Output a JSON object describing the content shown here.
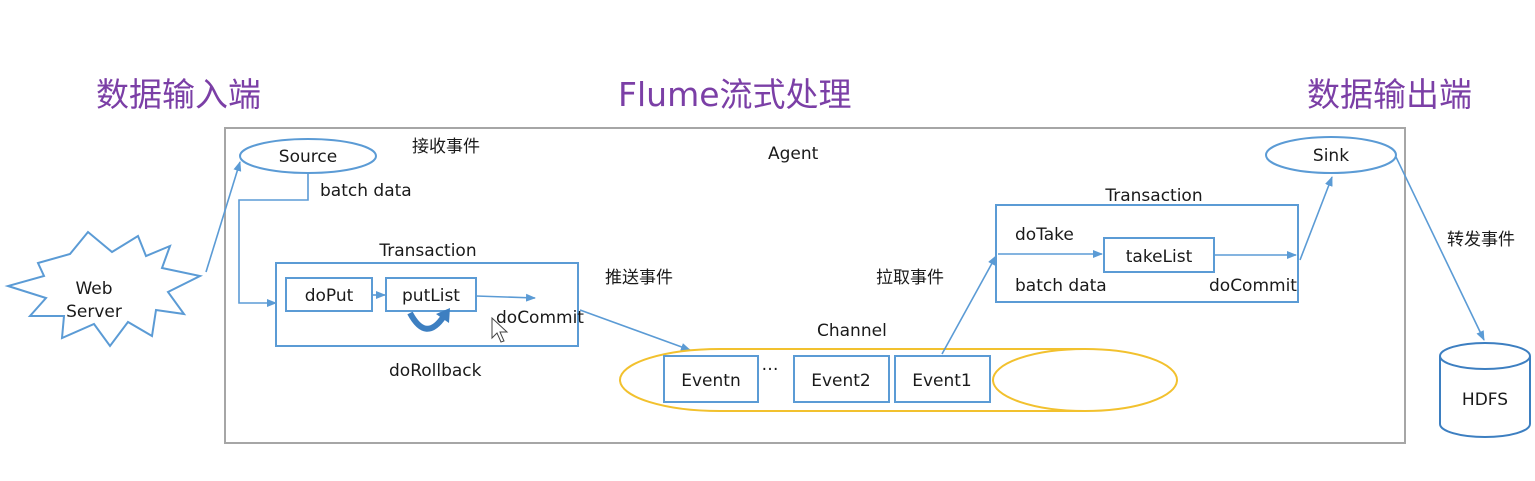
{
  "headings": {
    "input": "数据输入端",
    "center": "Flume流式处理",
    "output": "数据输出端"
  },
  "agent": {
    "label": "Agent"
  },
  "web_server": {
    "line1": "Web",
    "line2": "Server"
  },
  "source": {
    "label": "Source",
    "receive": "接收事件",
    "batch": "batch data"
  },
  "put_tx": {
    "title": "Transaction",
    "do_put": "doPut",
    "put_list": "putList",
    "do_commit": "doCommit",
    "do_rollback": "doRollback",
    "push": "推送事件"
  },
  "channel": {
    "label": "Channel",
    "events": [
      "Eventn",
      "Event2",
      "Event1"
    ],
    "ellipsis": "…",
    "accent": "#f2c12e"
  },
  "take_tx": {
    "title": "Transaction",
    "do_take": "doTake",
    "take_list": "takeList",
    "batch": "batch data",
    "do_commit": "doCommit",
    "pull": "拉取事件"
  },
  "sink": {
    "label": "Sink",
    "forward": "转发事件"
  },
  "hdfs": {
    "label": "HDFS"
  },
  "colors": {
    "line": "#5b9bd5",
    "heading": "#7b3fa6",
    "frame": "#a6a6a6"
  }
}
